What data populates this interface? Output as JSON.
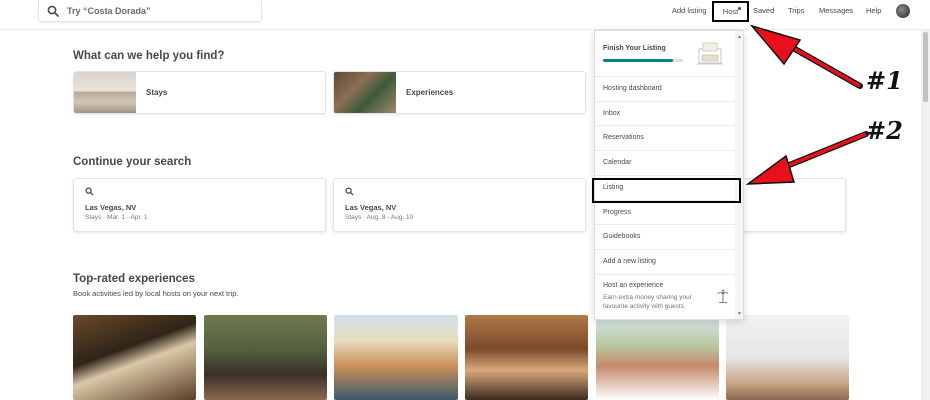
{
  "header": {
    "search_placeholder": "Try “Costa Dorada”",
    "nav": {
      "add_listing": "Add listing",
      "host": "Host",
      "saved": "Saved",
      "trips": "Trips",
      "messages": "Messages",
      "help": "Help"
    }
  },
  "find": {
    "title": "What can we help you find?",
    "categories": [
      {
        "label": "Stays"
      },
      {
        "label": "Experiences"
      }
    ]
  },
  "continue": {
    "title": "Continue your search",
    "cards": [
      {
        "place": "Las Vegas, NV",
        "dates": "Stays · Mar. 1 - Apr. 1"
      },
      {
        "place": "Las Vegas, NV",
        "dates": "Stays · Aug. 8 - Aug. 10"
      }
    ]
  },
  "experiences": {
    "title": "Top-rated experiences",
    "subtitle": "Book activities led by local hosts on your next trip."
  },
  "host_menu": {
    "finish_title": "Finish Your Listing",
    "progress": 0.88,
    "items": [
      {
        "label": "Hosting dashboard"
      },
      {
        "label": "Inbox"
      },
      {
        "label": "Reservations"
      },
      {
        "label": "Calendar"
      },
      {
        "label": "Listing"
      },
      {
        "label": "Progress"
      },
      {
        "label": "Guidebooks"
      },
      {
        "label": "Add a new listing"
      }
    ],
    "host_experience_title": "Host an experience",
    "host_experience_desc": "Earn extra money sharing your favourite activity with guests."
  },
  "annotations": {
    "label1": "#1",
    "label2": "#2"
  },
  "colors": {
    "accent": "#008489",
    "arrow": "#e8101a"
  }
}
